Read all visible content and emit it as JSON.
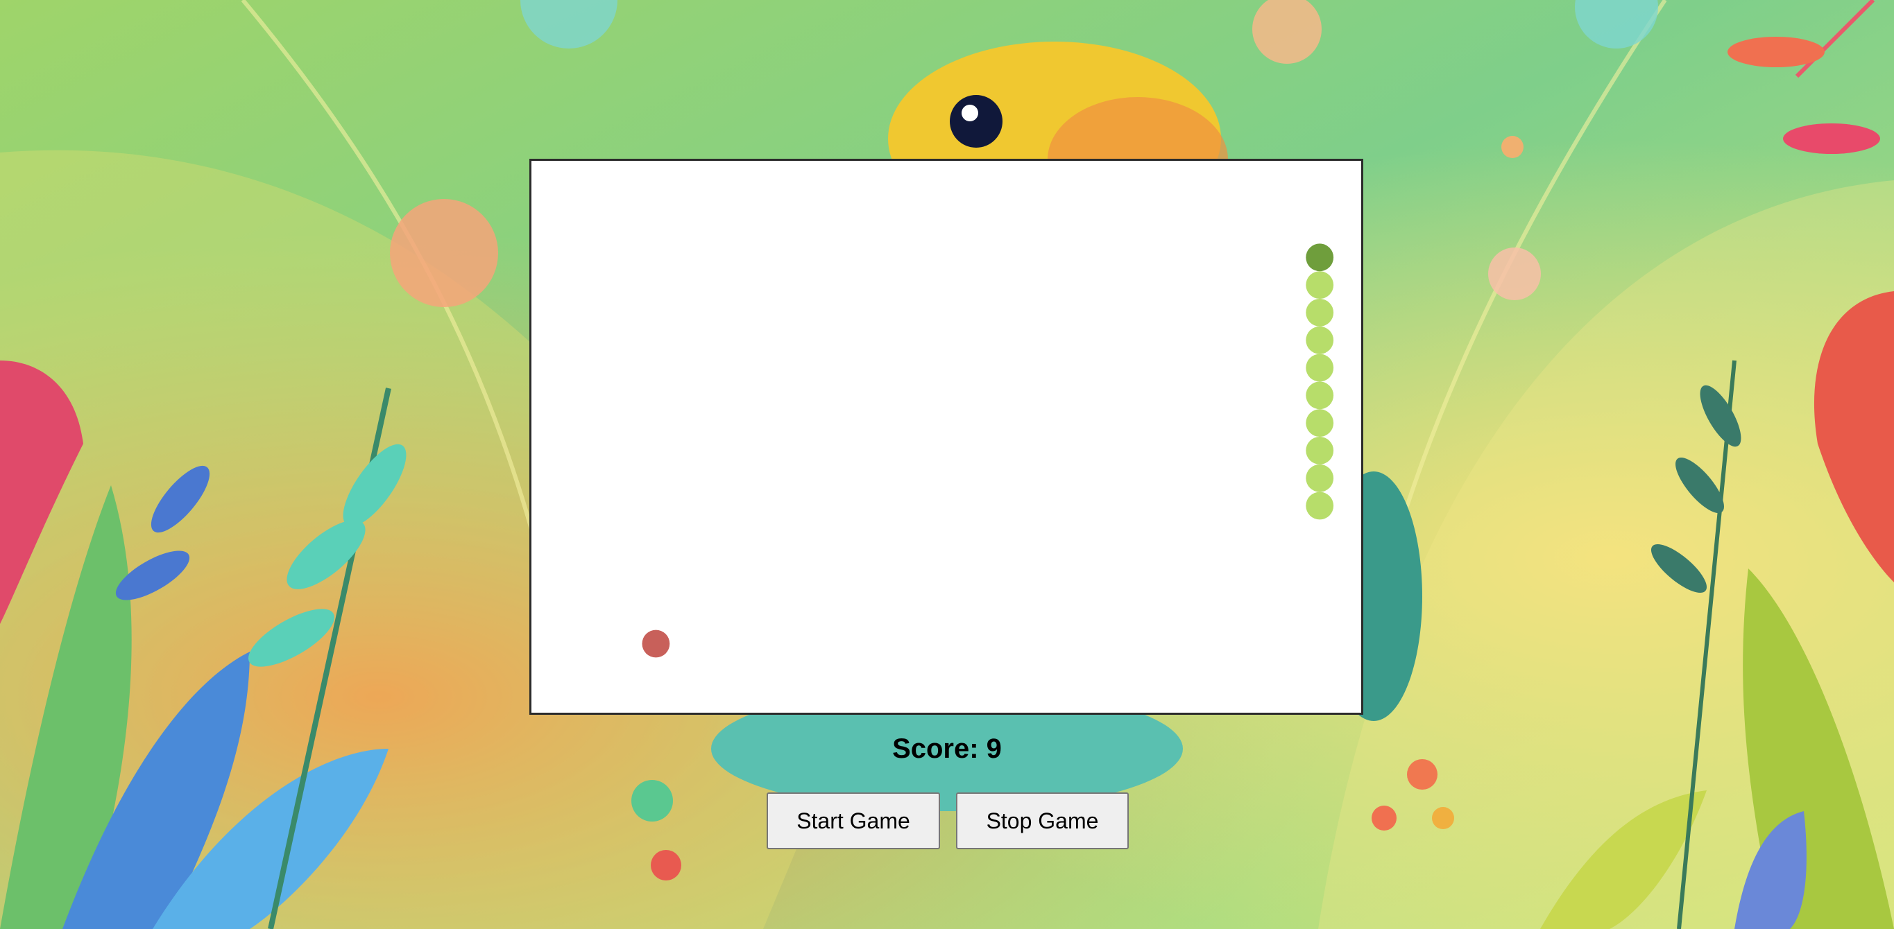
{
  "game": {
    "score_label": "Score:",
    "score": 9,
    "score_text": "Score: 9",
    "start_label": "Start Game",
    "stop_label": "Stop Game"
  },
  "board": {
    "cols": 30,
    "rows": 20,
    "snake": [
      [
        28,
        3
      ],
      [
        28,
        4
      ],
      [
        28,
        5
      ],
      [
        28,
        6
      ],
      [
        28,
        7
      ],
      [
        28,
        8
      ],
      [
        28,
        9
      ],
      [
        28,
        10
      ],
      [
        28,
        11
      ],
      [
        28,
        12
      ]
    ],
    "food": [
      4,
      17
    ]
  },
  "colors": {
    "snake_head": "#6f9e3c",
    "snake_body": "#b7dd6a",
    "food": "#c8605a",
    "board_bg": "#ffffff",
    "board_border": "#2b2b2b",
    "button_bg": "#efefef"
  },
  "background": {
    "description_icon": "jungle-snake-illustration"
  }
}
